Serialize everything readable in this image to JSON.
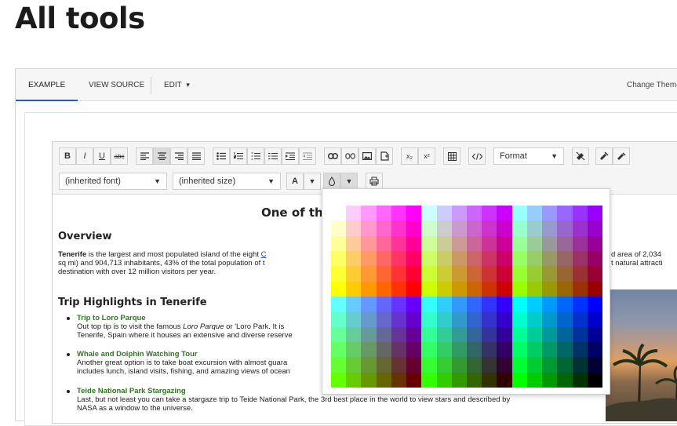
{
  "page": {
    "title": "All tools"
  },
  "demo_tabs": {
    "example": "EXAMPLE",
    "view_source": "VIEW SOURCE",
    "edit": "EDIT",
    "edit_caret": "▾",
    "change_theme": "Change Theme"
  },
  "toolbar": {
    "bold": "B",
    "italic": "I",
    "underline": "U",
    "strike": "abc",
    "sub": "x₂",
    "sup": "x²",
    "font": "(inherited font)",
    "size": "(inherited size)",
    "format": "Format",
    "font_color": "A",
    "caret": "▼"
  },
  "article": {
    "title": "One of the",
    "overview_heading": "Overview",
    "para_bold": "Tenerife",
    "para_text1": " is the largest and most populated island of the eight ",
    "para_link": "C",
    "para_line2": "sq mi) and 904,713 inhabitants, 43% of the total population of t",
    "para_line3": "destination with over 12 million visitors per year.",
    "para_right1": "d area of 2,034",
    "para_right2": "t natural attracti",
    "trip_heading": "Trip Highlights in Tenerife",
    "items": [
      {
        "title": "Trip to Loro Parque",
        "line1_a": "Out top tip is to visit the famous ",
        "line1_em": "Loro Parque",
        "line1_b": " or 'Loro Park. It is ",
        "line2": "Tenerife, Spain where it houses an extensive and diverse reserve"
      },
      {
        "title": "Whale and Dolphin Watching Tour",
        "line1": "Another great option is to take boat excursion with almost guara",
        "line2": "includes lunch, island visits, fishing, and amazing views of ocean"
      },
      {
        "title": "Teide National Park Stargazing",
        "line1": "Last, but not least you can take a stargaze trip to Teide National Park, the 3rd best place in the world to view stars and described by",
        "line2": "NASA as a window to the universe."
      }
    ]
  },
  "palette": {
    "colors": [
      [
        "#ffffff",
        "#ffccff",
        "#ff99ff",
        "#ff66ff",
        "#ff33ff",
        "#ff00ff",
        "#ccffff",
        "#ccccff",
        "#cc99ff",
        "#cc66ff",
        "#cc33ff",
        "#cc00ff",
        "#99ffff",
        "#99ccff",
        "#9999ff",
        "#9966ff",
        "#9933ff",
        "#9900ff"
      ],
      [
        "#ffffcc",
        "#ffcccc",
        "#ff99cc",
        "#ff66cc",
        "#ff33cc",
        "#ff00cc",
        "#ccffcc",
        "#cccccc",
        "#cc99cc",
        "#cc66cc",
        "#cc33cc",
        "#cc00cc",
        "#99ffcc",
        "#99cccc",
        "#9999cc",
        "#9966cc",
        "#9933cc",
        "#9900cc"
      ],
      [
        "#ffff99",
        "#ffcc99",
        "#ff9999",
        "#ff6699",
        "#ff3399",
        "#ff0099",
        "#ccff99",
        "#cccc99",
        "#cc9999",
        "#cc6699",
        "#cc3399",
        "#cc0099",
        "#99ff99",
        "#99cc99",
        "#999999",
        "#996699",
        "#993399",
        "#990099"
      ],
      [
        "#ffff66",
        "#ffcc66",
        "#ff9966",
        "#ff6666",
        "#ff3366",
        "#ff0066",
        "#ccff66",
        "#cccc66",
        "#cc9966",
        "#cc6666",
        "#cc3366",
        "#cc0066",
        "#99ff66",
        "#99cc66",
        "#999966",
        "#996666",
        "#993366",
        "#990066"
      ],
      [
        "#ffff33",
        "#ffcc33",
        "#ff9933",
        "#ff6633",
        "#ff3333",
        "#ff0033",
        "#ccff33",
        "#cccc33",
        "#cc9933",
        "#cc6633",
        "#cc3333",
        "#cc0033",
        "#99ff33",
        "#99cc33",
        "#999933",
        "#996633",
        "#993333",
        "#990033"
      ],
      [
        "#ffff00",
        "#ffcc00",
        "#ff9900",
        "#ff6600",
        "#ff3300",
        "#ff0000",
        "#ccff00",
        "#cccc00",
        "#cc9900",
        "#cc6600",
        "#cc3300",
        "#cc0000",
        "#99ff00",
        "#99cc00",
        "#999900",
        "#996600",
        "#993300",
        "#990000"
      ],
      [
        "#66ffff",
        "#66ccff",
        "#6699ff",
        "#6666ff",
        "#6633ff",
        "#6600ff",
        "#33ffff",
        "#33ccff",
        "#3399ff",
        "#3366ff",
        "#3333ff",
        "#3300ff",
        "#00ffff",
        "#00ccff",
        "#0099ff",
        "#0066ff",
        "#0033ff",
        "#0000ff"
      ],
      [
        "#66ffcc",
        "#66cccc",
        "#6699cc",
        "#6666cc",
        "#6633cc",
        "#6600cc",
        "#33ffcc",
        "#33cccc",
        "#3399cc",
        "#3366cc",
        "#3333cc",
        "#3300cc",
        "#00ffcc",
        "#00cccc",
        "#0099cc",
        "#0066cc",
        "#0033cc",
        "#0000cc"
      ],
      [
        "#66ff99",
        "#66cc99",
        "#669999",
        "#666699",
        "#663399",
        "#660099",
        "#33ff99",
        "#33cc99",
        "#339999",
        "#336699",
        "#333399",
        "#330099",
        "#00ff99",
        "#00cc99",
        "#009999",
        "#006699",
        "#003399",
        "#000099"
      ],
      [
        "#66ff66",
        "#66cc66",
        "#669966",
        "#666666",
        "#663366",
        "#660066",
        "#33ff66",
        "#33cc66",
        "#339966",
        "#336666",
        "#333366",
        "#330066",
        "#00ff66",
        "#00cc66",
        "#009966",
        "#006666",
        "#003366",
        "#000066"
      ],
      [
        "#66ff33",
        "#66cc33",
        "#669933",
        "#666633",
        "#663333",
        "#660033",
        "#33ff33",
        "#33cc33",
        "#339933",
        "#336633",
        "#333333",
        "#330033",
        "#00ff33",
        "#00cc33",
        "#009933",
        "#006633",
        "#003333",
        "#000033"
      ],
      [
        "#66ff00",
        "#66cc00",
        "#669900",
        "#666600",
        "#663300",
        "#660000",
        "#33ff00",
        "#33cc00",
        "#339900",
        "#336600",
        "#333300",
        "#330000",
        "#00ff00",
        "#00cc00",
        "#009900",
        "#006600",
        "#003300",
        "#000000"
      ]
    ]
  }
}
